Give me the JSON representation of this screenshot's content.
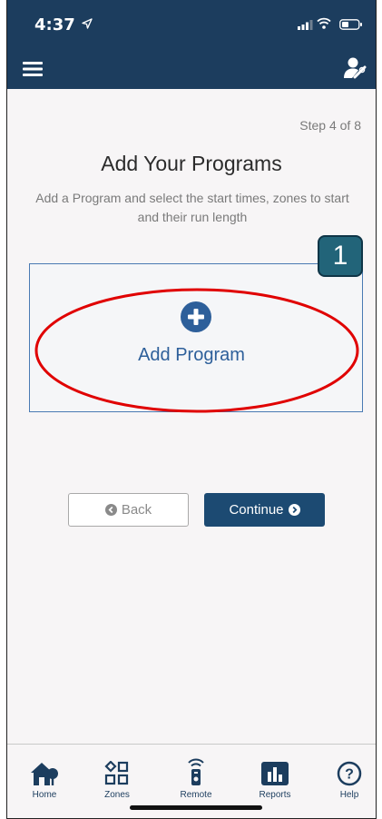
{
  "status": {
    "time": "4:37"
  },
  "content": {
    "step": "Step 4 of 8",
    "title": "Add Your Programs",
    "subtitle": "Add a Program and select the start times, zones to start and their run length",
    "add_program_label": "Add Program",
    "annotation_number": "1"
  },
  "buttons": {
    "back": "Back",
    "continue": "Continue"
  },
  "tabs": [
    {
      "label": "Home",
      "icon": "home-icon"
    },
    {
      "label": "Zones",
      "icon": "zones-icon"
    },
    {
      "label": "Remote",
      "icon": "remote-icon"
    },
    {
      "label": "Reports",
      "icon": "reports-icon"
    },
    {
      "label": "Help",
      "icon": "help-icon"
    }
  ],
  "colors": {
    "header": "#1c3d5e",
    "accent": "#2d5f9a",
    "annotation_oval": "#e00000",
    "annotation_badge": "#226479"
  }
}
